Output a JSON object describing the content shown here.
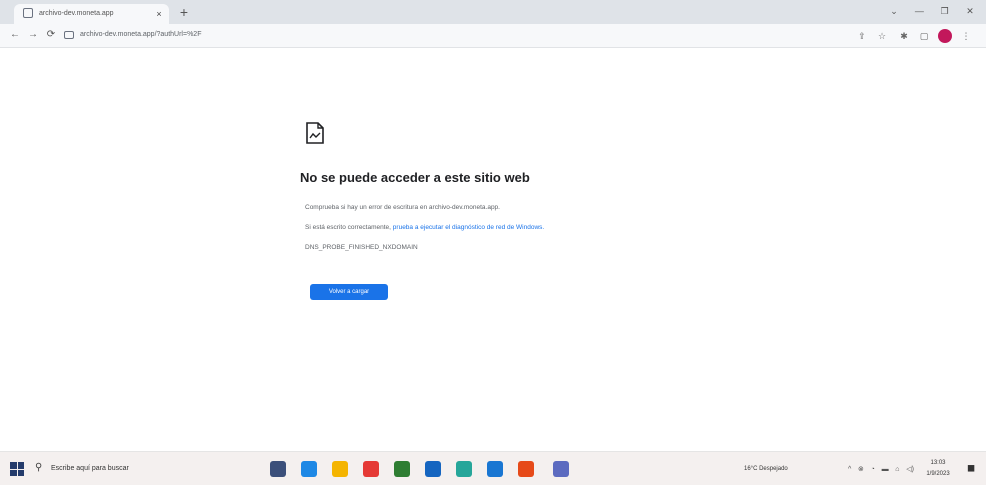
{
  "browser": {
    "tab": {
      "title": "archivo-dev.moneta.app",
      "close_glyph": "×",
      "new_tab_glyph": "+"
    },
    "window_controls": {
      "chevron": "⌄",
      "minimize": "—",
      "restore": "❐",
      "close": "✕"
    },
    "toolbar": {
      "back": "←",
      "forward": "→",
      "reload": "⟳",
      "url": "archivo-dev.moneta.app/?authUrl=%2F",
      "right_icons": {
        "share": "⇪",
        "star": "☆",
        "extension": "✱",
        "split": "▢",
        "menu": "⋮"
      },
      "profile_color": "#c2185b"
    }
  },
  "error_page": {
    "title": "No se puede acceder a este sitio web",
    "line1": "Comprueba si hay un error de escritura en archivo-dev.moneta.app.",
    "line2_prefix": "Si está escrito correctamente,",
    "line2_link": "prueba a ejecutar el diagnóstico de red de Windows.",
    "error_code": "DNS_PROBE_FINISHED_NXDOMAIN",
    "reload_button": "Volver a cargar",
    "button_color": "#1a73e8"
  },
  "taskbar": {
    "search_glyph": "⚲",
    "search_placeholder": "Escribe aquí para buscar",
    "weather": "16°C Despejado",
    "tray_glyphs": [
      "^",
      "⊗",
      "◔",
      "▬",
      "⌂",
      "◁)"
    ],
    "clock_time": "13:03",
    "clock_date": "1/9/2023",
    "notification_glyph": "◼",
    "apps": [
      {
        "name": "task-view",
        "color": "#3b4f7a"
      },
      {
        "name": "edge",
        "color": "#1e88e5"
      },
      {
        "name": "file-explorer",
        "color": "#f4b400"
      },
      {
        "name": "chrome-red",
        "color": "#e53935"
      },
      {
        "name": "teams",
        "color": "#2e7d32"
      },
      {
        "name": "outlook",
        "color": "#1565c0"
      },
      {
        "name": "store",
        "color": "#26a69a"
      },
      {
        "name": "vscode",
        "color": "#1976d2"
      },
      {
        "name": "chrome",
        "color": "#e64a19"
      },
      {
        "name": "app-window",
        "color": "#5c6bc0"
      }
    ]
  }
}
